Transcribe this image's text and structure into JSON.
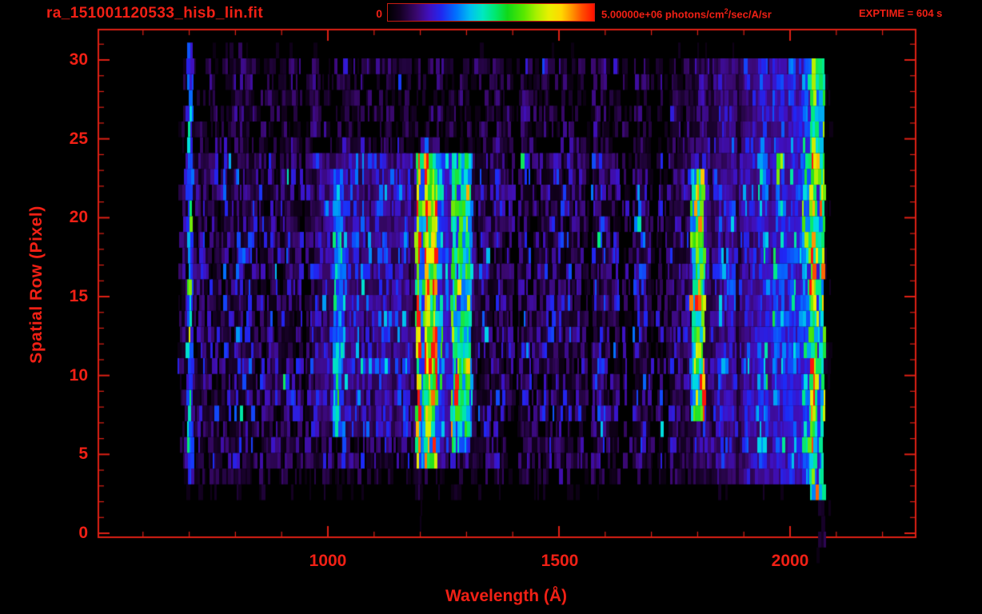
{
  "header": {
    "title": "ra_151001120533_hisb_lin.fit",
    "exptime_label": "EXPTIME = 604 s",
    "colorbar": {
      "min_label": "0",
      "max_label_prefix": "5.00000e+06 photons/cm",
      "max_label_sup": "2",
      "max_label_suffix": "/sec/A/sr"
    }
  },
  "colors": {
    "text_red": "#f02015",
    "axis_red": "#de2015",
    "background": "#000000"
  },
  "chart_data": {
    "type": "heatmap",
    "title": "ra_151001120533_hisb_lin.fit",
    "xlabel": "Wavelength (Å)",
    "ylabel": "Spatial Row (Pixel)",
    "xlim": [
      500,
      2270
    ],
    "ylim": [
      -0.3,
      32
    ],
    "x_ticks": [
      1000,
      1500,
      2000
    ],
    "x_minor_step": 100,
    "x_minor_range": [
      600,
      2200
    ],
    "y_ticks": [
      0,
      5,
      10,
      15,
      20,
      25,
      30
    ],
    "y_minor_step": 1,
    "grid": false,
    "colorbar": {
      "min": 0,
      "max": 5000000,
      "units": "photons/cm2/sec/A/sr",
      "colormap": "rainbow",
      "position": "top"
    },
    "exposure_time_s": 604,
    "data_extent": {
      "wavelength_min": 676,
      "wavelength_max": 2075,
      "row_min": 0,
      "row_max": 31
    },
    "row_profile": [
      0.012,
      0.012,
      0.015,
      0.05,
      0.1,
      0.19,
      0.22,
      0.2,
      0.24,
      0.24,
      0.24,
      0.24,
      0.24,
      0.24,
      0.24,
      0.24,
      0.24,
      0.24,
      0.24,
      0.24,
      0.24,
      0.24,
      0.24,
      0.24,
      0.22,
      0.15,
      0.13,
      0.12,
      0.11,
      0.13,
      0.15,
      0.05
    ],
    "features": [
      {
        "name": "blue-column-700",
        "wavelength": [
          696,
          708
        ],
        "rows": [
          4,
          31
        ],
        "level": 0.3
      },
      {
        "name": "lyman-beta-1025",
        "wavelength": [
          1012,
          1032
        ],
        "rows": [
          7,
          23
        ],
        "level": 0.3
      },
      {
        "name": "broad-glow-1000-1320",
        "wavelength": [
          975,
          1320
        ],
        "rows": [
          7,
          24
        ],
        "level": 0.09
      },
      {
        "name": "lyman-alpha-1216",
        "wavelength": [
          1190,
          1236
        ],
        "rows": [
          5,
          24
        ],
        "level": 0.5
      },
      {
        "name": "lyman-alpha-core",
        "wavelength": [
          1197,
          1222
        ],
        "rows": [
          5,
          24
        ],
        "level": 0.12
      },
      {
        "name": "lyman-alpha-cap",
        "wavelength": [
          1202,
          1220
        ],
        "rows": [
          24,
          25
        ],
        "level": 0.4
      },
      {
        "name": "band-1250",
        "wavelength": [
          1236,
          1268
        ],
        "rows": [
          6,
          24
        ],
        "level": 0.16
      },
      {
        "name": "line-1290",
        "wavelength": [
          1268,
          1312
        ],
        "rows": [
          6,
          24
        ],
        "level": 0.42
      },
      {
        "name": "line-1800",
        "wavelength": [
          1786,
          1815
        ],
        "rows": [
          8,
          23
        ],
        "level": 0.45
      },
      {
        "name": "right-ramp",
        "wavelength": [
          1700,
          2042
        ],
        "rows": [
          4,
          30
        ],
        "level": 0.3,
        "ramp": true
      },
      {
        "name": "edge-band-2060",
        "wavelength": [
          2042,
          2075
        ],
        "rows": [
          3,
          30
        ],
        "level": 0.55,
        "spikes": 0.1
      },
      {
        "name": "edge-below-axis",
        "wavelength": [
          2060,
          2076
        ],
        "rows": [
          -1.5,
          3
        ],
        "level": 0.1,
        "sparse": 0.45
      },
      {
        "name": "lya-below",
        "wavelength": [
          1193,
          1205
        ],
        "rows": [
          1,
          5
        ],
        "level": 0.09,
        "sparse": 0.6
      },
      {
        "name": "sparse-beyond-edge",
        "wavelength": [
          2076,
          2092
        ],
        "rows": [
          0,
          30
        ],
        "level": 0.06,
        "sparse": 0.18
      }
    ]
  }
}
